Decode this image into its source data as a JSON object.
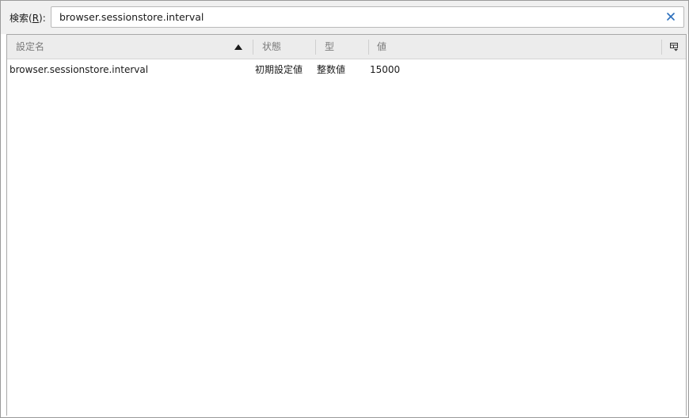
{
  "search": {
    "label_prefix": "検索(",
    "label_accel": "R",
    "label_suffix": "):",
    "value": "browser.sessionstore.interval"
  },
  "columns": {
    "name": "設定名",
    "status": "状態",
    "type": "型",
    "value": "値"
  },
  "rows": [
    {
      "name": "browser.sessionstore.interval",
      "status": "初期設定値",
      "type": "整数値",
      "value": "15000"
    }
  ],
  "icons": {
    "clear": "close-icon",
    "sort": "sort-ascending-icon",
    "column_picker": "column-picker-icon"
  },
  "colors": {
    "clear_icon": "#2a6ebc"
  }
}
